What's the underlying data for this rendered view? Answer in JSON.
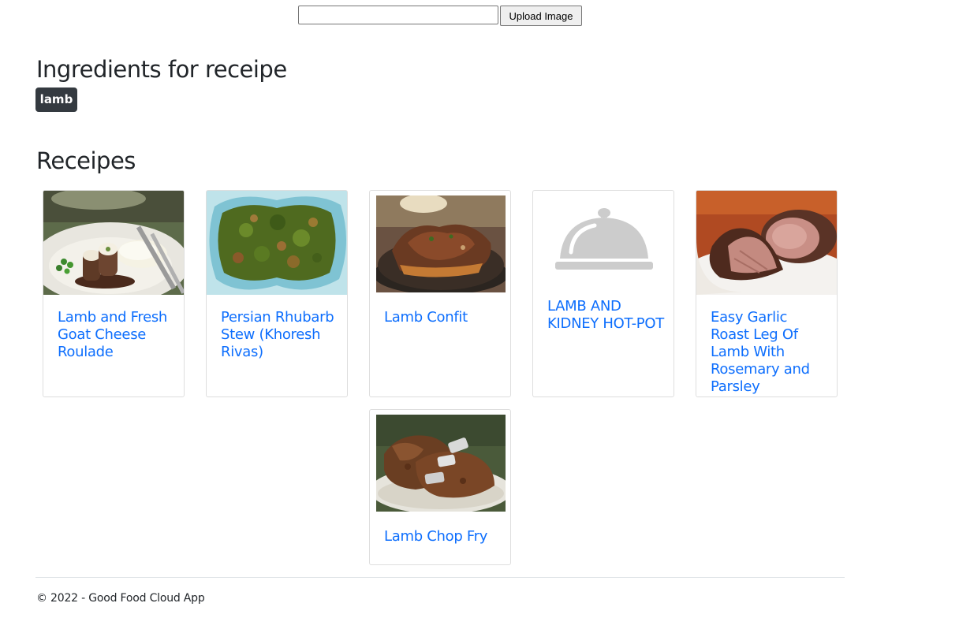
{
  "upload": {
    "input_value": "",
    "button_label": "Upload Image"
  },
  "ingredients": {
    "heading": "Ingredients for receipe",
    "tags": [
      "lamb"
    ]
  },
  "recipes": {
    "heading": "Receipes",
    "items": [
      {
        "title": "Lamb and Fresh Goat Cheese Roulade",
        "image": "lamb-roulade-photo"
      },
      {
        "title": "Persian Rhubarb Stew (Khoresh Rivas)",
        "image": "green-stew-photo"
      },
      {
        "title": "Lamb Confit",
        "image": "lamb-confit-photo"
      },
      {
        "title": "LAMB AND KIDNEY HOT-POT",
        "image": "cloche-placeholder-icon"
      },
      {
        "title": "Easy Garlic Roast Leg Of Lamb With Rosemary and Parsley",
        "image": "roast-lamb-photo"
      },
      {
        "title": "Lamb Chop Fry",
        "image": "lamb-chop-fry-photo"
      }
    ]
  },
  "footer": {
    "text": "© 2022 - Good Food Cloud App"
  },
  "colors": {
    "link": "#0d6efd",
    "badge_bg": "#343a40",
    "placeholder_gray": "#cccccc"
  }
}
